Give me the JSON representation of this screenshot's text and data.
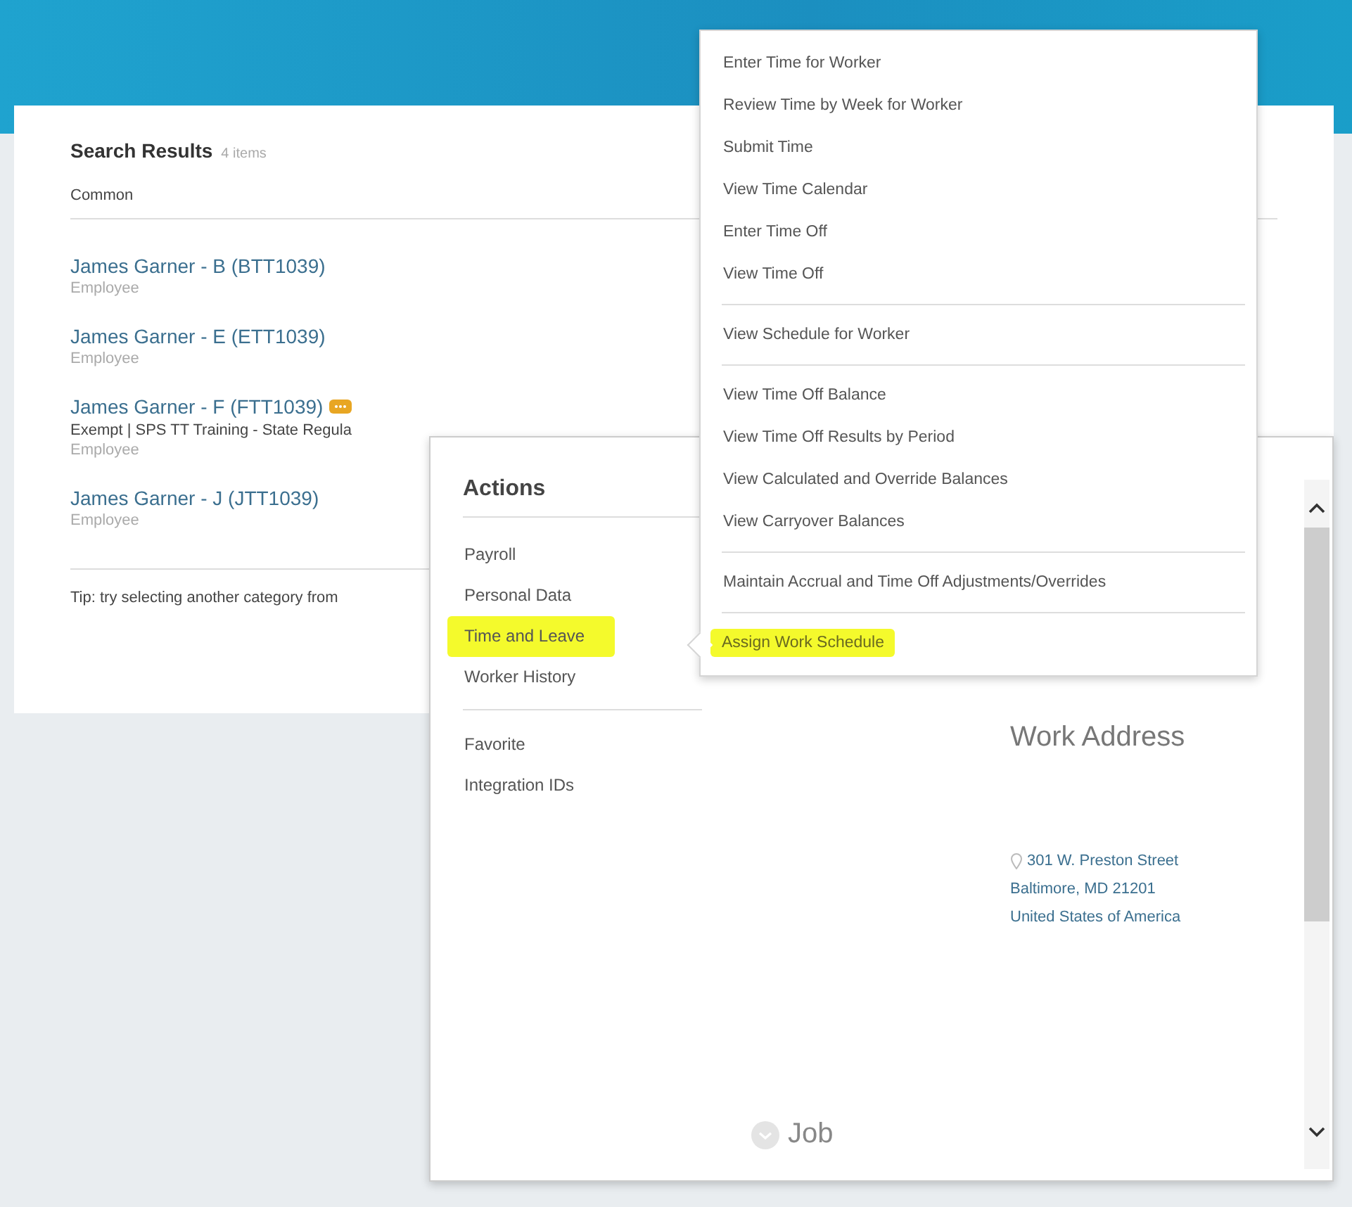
{
  "search_results": {
    "title": "Search Results",
    "count": "4 items",
    "category": "Common",
    "results": [
      {
        "name": "James Garner - B (BTT1039)",
        "type": "Employee",
        "badge": false
      },
      {
        "name": "James Garner - E (ETT1039)",
        "type": "Employee",
        "badge": false
      },
      {
        "name": "James Garner - F (FTT1039)",
        "details": [
          "Exempt | SPS TT Training - State Regula"
        ],
        "type": "Employee",
        "badge": true
      },
      {
        "name": "James Garner - J (JTT1039)",
        "type": "Employee",
        "badge": false
      }
    ],
    "tip": "Tip: try selecting another category from"
  },
  "worker_popup": {
    "actions": {
      "title": "Actions",
      "groups": [
        [
          {
            "label": "Payroll",
            "selected": false
          },
          {
            "label": "Personal Data",
            "selected": false
          },
          {
            "label": "Time and Leave",
            "selected": true
          },
          {
            "label": "Worker History",
            "selected": false
          }
        ],
        [
          {
            "label": "Favorite",
            "selected": false
          },
          {
            "label": "Integration IDs",
            "selected": false
          }
        ]
      ]
    },
    "work_address": {
      "title": "Work Address",
      "lines": [
        "301 W. Preston Street",
        "Baltimore, MD 21201",
        "United States of America"
      ]
    },
    "section": "Job"
  },
  "submenu": {
    "groups": [
      [
        {
          "label": "Enter Time for Worker",
          "selected": false
        },
        {
          "label": "Review Time by Week for Worker",
          "selected": false
        },
        {
          "label": "Submit Time",
          "selected": false
        },
        {
          "label": "View Time Calendar",
          "selected": false
        },
        {
          "label": "Enter Time Off",
          "selected": false
        },
        {
          "label": "View Time Off",
          "selected": false
        }
      ],
      [
        {
          "label": "View Schedule for Worker",
          "selected": false
        }
      ],
      [
        {
          "label": "View Time Off Balance",
          "selected": false
        },
        {
          "label": "View Time Off Results by Period",
          "selected": false
        },
        {
          "label": "View Calculated and Override Balances",
          "selected": false
        },
        {
          "label": "View Carryover Balances",
          "selected": false
        }
      ],
      [
        {
          "label": "Maintain Accrual and Time Off Adjustments/Overrides",
          "selected": false
        }
      ],
      [
        {
          "label": "Assign Work Schedule",
          "selected": true
        }
      ]
    ]
  }
}
